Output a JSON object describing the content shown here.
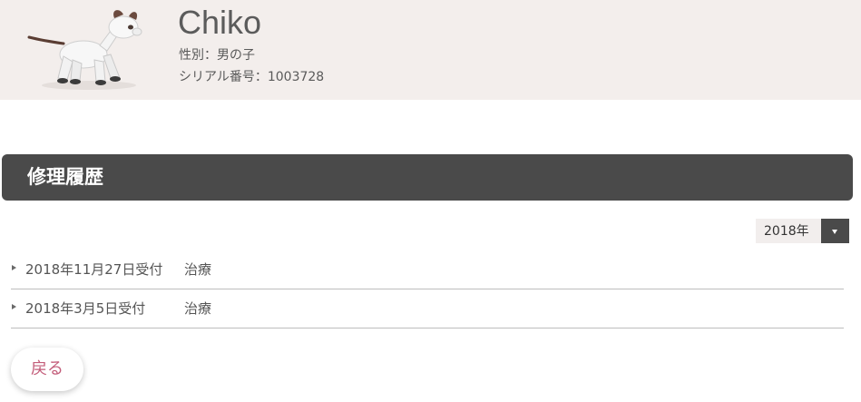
{
  "profile": {
    "name": "Chiko",
    "gender": "性別：男の子",
    "serial": "シリアル番号：1003728"
  },
  "section": {
    "title": "修理履歴"
  },
  "year_select": {
    "value": "2018年"
  },
  "history": [
    {
      "date": "2018年11月27日受付",
      "type": "治療"
    },
    {
      "date": "2018年3月5日受付",
      "type": "治療"
    }
  ],
  "actions": {
    "back_label": "戻る"
  },
  "colors": {
    "header_bg": "#f3eeec",
    "bar_bg": "#4a4a4a",
    "back_text": "#c35d7a"
  }
}
